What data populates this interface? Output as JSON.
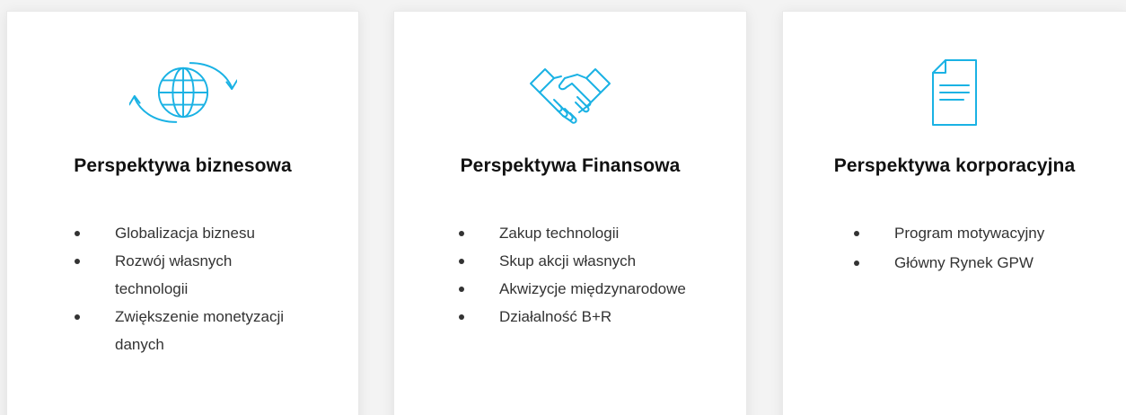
{
  "colors": {
    "accent": "#1ab2e4",
    "background": "#f3f3f3",
    "card": "#ffffff",
    "text": "#333333",
    "heading": "#111111"
  },
  "cards": [
    {
      "icon": "globe-refresh-icon",
      "title": "Perspektywa biznesowa",
      "items": [
        "Globalizacja biznesu",
        "Rozwój własnych technologii",
        "Zwiększenie monetyzacji danych"
      ]
    },
    {
      "icon": "handshake-icon",
      "title": "Perspektywa Finansowa",
      "items": [
        "Zakup technologii",
        "Skup akcji własnych",
        "Akwizycje międzynarodowe",
        "Działalność B+R"
      ]
    },
    {
      "icon": "document-icon",
      "title": "Perspektywa korporacyjna",
      "items": [
        "Program motywacyjny",
        "Główny Rynek GPW"
      ]
    }
  ]
}
